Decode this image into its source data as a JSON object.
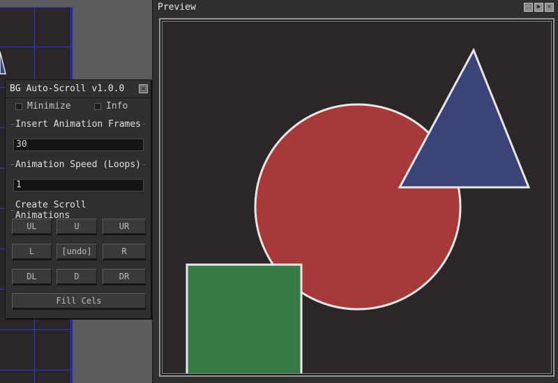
{
  "preview": {
    "title": "Preview",
    "icons": [
      "fullscreen-icon",
      "play-icon",
      "close-icon"
    ],
    "shapes": {
      "circle_color": "#a8393a",
      "triangle_color": "#3a4478",
      "square_color": "#377c46",
      "outline_color": "#e8e8e8",
      "background_color": "#2b2729"
    }
  },
  "dialog": {
    "title": "BG Auto-Scroll v1.0.0",
    "minimize_label": "Minimize",
    "info_label": "Info",
    "frames_section": "Insert Animation Frames",
    "frames_value": "30",
    "speed_section": "Animation Speed (Loops)",
    "speed_value": "1",
    "scroll_section": "Create Scroll Animations",
    "buttons": {
      "ul": "UL",
      "u": "U",
      "ur": "UR",
      "l": "L",
      "undo": "[undo]",
      "r": "R",
      "dl": "DL",
      "d": "D",
      "dr": "DR"
    },
    "fill_cels": "Fill Cels"
  },
  "colors": {
    "grid_line": "#2f39d6",
    "panel_bg": "#2f2f2f",
    "workspace_bg": "#5c5c5c"
  }
}
